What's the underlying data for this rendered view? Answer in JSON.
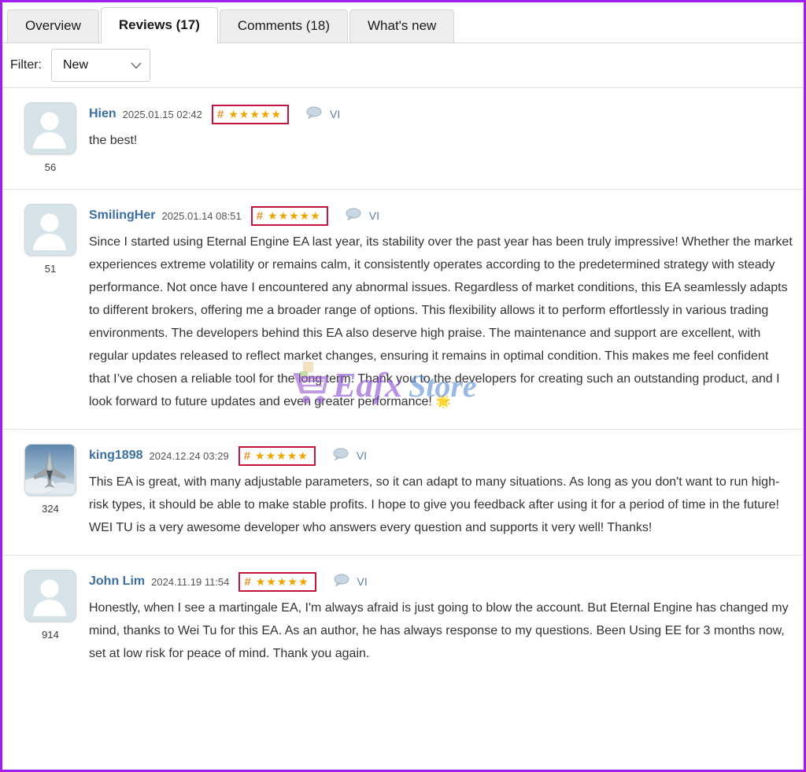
{
  "theme": {
    "page_border_color": "#a01ff0",
    "active_tab_bg": "#ffffff",
    "tab_bg": "#eeeeee",
    "username_color": "#3b6ea5",
    "star_color": "#f0a500",
    "rating_border_color": "#c2143c",
    "lang_color": "#5a7fa6"
  },
  "tabs": [
    {
      "label": "Overview",
      "active": false
    },
    {
      "label": "Reviews (17)",
      "active": true
    },
    {
      "label": "Comments (18)",
      "active": false
    },
    {
      "label": "What's new",
      "active": false
    }
  ],
  "filter": {
    "label": "Filter:",
    "value": "New",
    "options": [
      "New"
    ],
    "chevron_icon": "chevron-down-icon"
  },
  "reviews": [
    {
      "username": "Hien",
      "timestamp": "2025.01.15 02:42",
      "rating": 5,
      "rating_hash": "#",
      "stars": "★★★★★",
      "language": "VI",
      "avatar_type": "default-person",
      "avatar_count": "56",
      "text": "the best!"
    },
    {
      "username": "SmilingHer",
      "timestamp": "2025.01.14 08:51",
      "rating": 5,
      "rating_hash": "#",
      "stars": "★★★★★",
      "language": "VI",
      "avatar_type": "default-person",
      "avatar_count": "51",
      "text": "Since I started using Eternal Engine EA last year, its stability over the past year has been truly impressive! Whether the market experiences extreme volatility or remains calm, it consistently operates according to the predetermined strategy with steady performance. Not once have I encountered any abnormal issues. Regardless of market conditions, this EA seamlessly adapts to different brokers, offering me a broader range of options. This flexibility allows it to perform effortlessly in various trading environments. The developers behind this EA also deserve high praise. The maintenance and support are excellent, with regular updates released to reflect market changes, ensuring it remains in optimal condition. This makes me feel confident that I’ve chosen a reliable tool for the long term. Thank you to the developers for creating such an outstanding product, and I look forward to future updates and even greater performance! 🌟"
    },
    {
      "username": "king1898",
      "timestamp": "2024.12.24 03:29",
      "rating": 5,
      "rating_hash": "#",
      "stars": "★★★★★",
      "language": "VI",
      "avatar_type": "fighter-jet-photo",
      "avatar_count": "324",
      "text": "This EA is great, with many adjustable parameters, so it can adapt to many situations. As long as you don't want to run high-risk types, it should be able to make stable profits. I hope to give you feedback after using it for a period of time in the future! WEI TU is a very awesome developer who answers every question and supports it very well! Thanks!"
    },
    {
      "username": "John Lim",
      "timestamp": "2024.11.19 11:54",
      "rating": 5,
      "rating_hash": "#",
      "stars": "★★★★★",
      "language": "VI",
      "avatar_type": "default-person",
      "avatar_count": "914",
      "text": "Honestly, when I see a martingale EA, I'm always afraid is just going to blow the account. But Eternal Engine has changed my mind, thanks to Wei Tu for this EA. As an author, he has always response to my questions. Been Using EE for 3 months now, set at low risk for peace of mind. Thank you again."
    }
  ],
  "watermark": {
    "text_primary": "Eafx",
    "text_secondary": "Store",
    "icon": "shopping-cart-icon",
    "primary_color": "#8b4fd4",
    "secondary_color": "#5b8fd4"
  }
}
